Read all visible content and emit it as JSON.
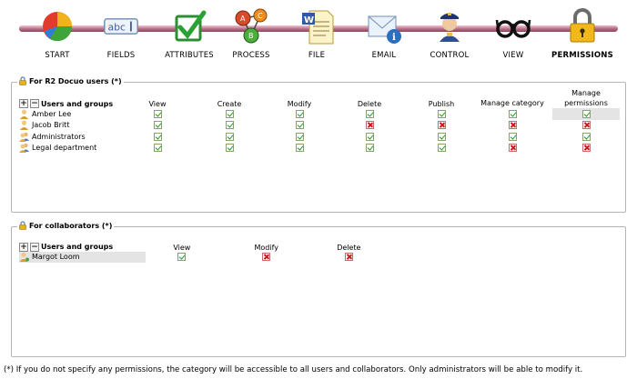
{
  "wizard": {
    "steps": [
      {
        "key": "start",
        "label": "START",
        "icon": "pie-chart-icon"
      },
      {
        "key": "fields",
        "label": "FIELDS",
        "icon": "text-field-icon"
      },
      {
        "key": "attributes",
        "label": "ATTRIBUTES",
        "icon": "checkbox-icon"
      },
      {
        "key": "process",
        "label": "PROCESS",
        "icon": "process-nodes-icon"
      },
      {
        "key": "file",
        "label": "FILE",
        "icon": "word-document-icon"
      },
      {
        "key": "email",
        "label": "EMAIL",
        "icon": "envelope-info-icon"
      },
      {
        "key": "control",
        "label": "CONTROL",
        "icon": "police-officer-icon"
      },
      {
        "key": "view",
        "label": "VIEW",
        "icon": "glasses-icon"
      },
      {
        "key": "permissions",
        "label": "PERMISSIONS",
        "icon": "padlock-icon"
      }
    ],
    "active": "permissions"
  },
  "users_section": {
    "title": "For R2 Docuo users (*)",
    "col_users": "Users and groups",
    "columns": [
      "View",
      "Create",
      "Modify",
      "Delete",
      "Publish",
      "Manage category",
      "Manage permissions"
    ],
    "rows": [
      {
        "name": "Amber Lee",
        "icon": "user-icon",
        "perms": [
          true,
          true,
          true,
          true,
          true,
          true,
          true
        ]
      },
      {
        "name": "Jacob Britt",
        "icon": "user-icon",
        "perms": [
          true,
          true,
          true,
          false,
          false,
          false,
          false
        ]
      },
      {
        "name": "Administrators",
        "icon": "group-icon",
        "perms": [
          true,
          true,
          true,
          true,
          true,
          true,
          true
        ]
      },
      {
        "name": "Legal department",
        "icon": "group-icon",
        "perms": [
          true,
          true,
          true,
          true,
          true,
          false,
          false
        ]
      }
    ]
  },
  "collab_section": {
    "title": "For collaborators (*)",
    "col_users": "Users and groups",
    "columns": [
      "View",
      "Modify",
      "Delete"
    ],
    "rows": [
      {
        "name": "Margot Loom",
        "icon": "collaborator-icon",
        "perms": [
          true,
          false,
          false
        ]
      }
    ]
  },
  "footnote": "(*) If you do not specify any permissions, the category will be accessible to all users and collaborators. Only administrators will be able to modify it.",
  "colors": {
    "check": "#1f9a2a",
    "cross": "#d01818",
    "track": "#b0657f"
  }
}
